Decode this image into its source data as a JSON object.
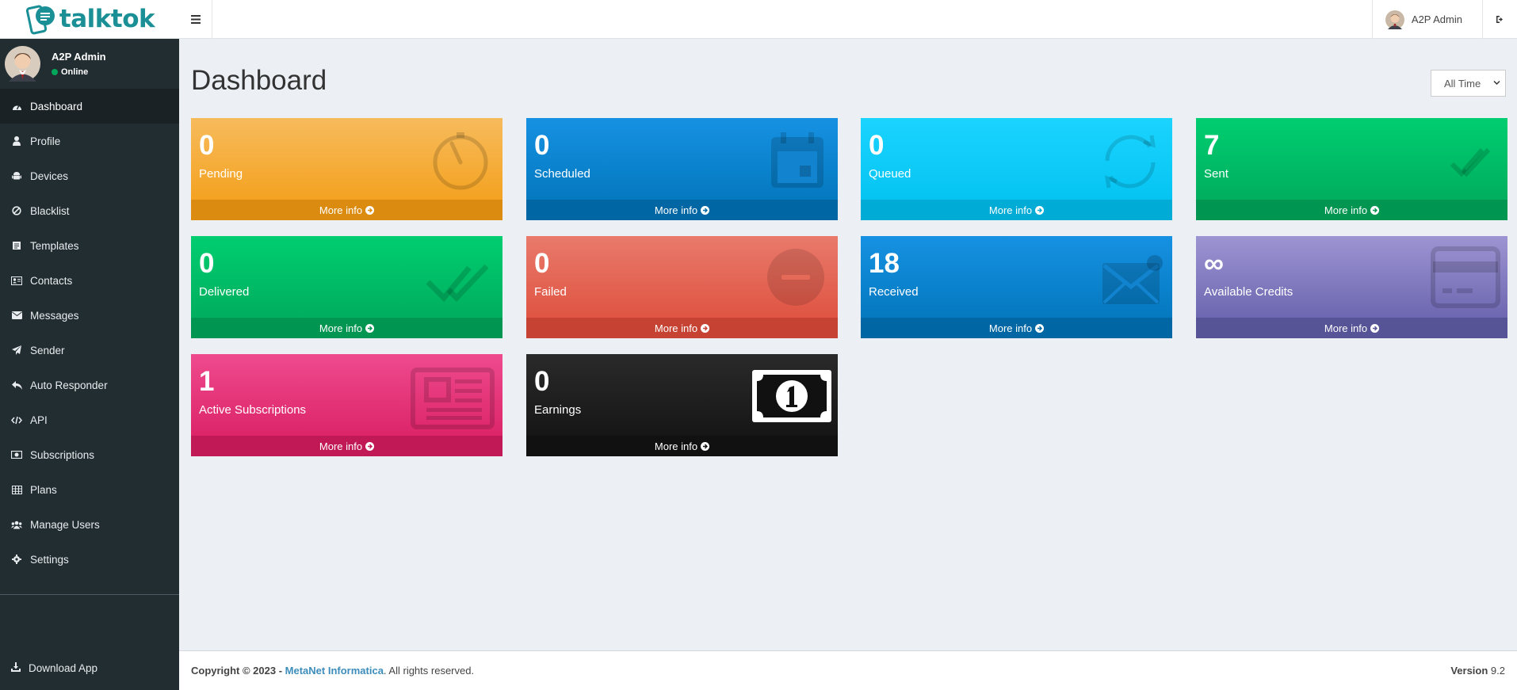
{
  "brand": {
    "name": "talktok",
    "color": "#1a8f95"
  },
  "topbar": {
    "user_name": "A2P Admin"
  },
  "sidebar": {
    "user": {
      "name": "A2P Admin",
      "status": "Online"
    },
    "items": [
      {
        "label": "Dashboard",
        "icon": "dashboard-icon",
        "active": true
      },
      {
        "label": "Profile",
        "icon": "user-icon"
      },
      {
        "label": "Devices",
        "icon": "android-icon"
      },
      {
        "label": "Blacklist",
        "icon": "ban-icon"
      },
      {
        "label": "Templates",
        "icon": "template-icon"
      },
      {
        "label": "Contacts",
        "icon": "address-card-icon"
      },
      {
        "label": "Messages",
        "icon": "envelope-icon"
      },
      {
        "label": "Sender",
        "icon": "paper-plane-icon"
      },
      {
        "label": "Auto Responder",
        "icon": "reply-icon"
      },
      {
        "label": "API",
        "icon": "code-icon"
      },
      {
        "label": "Subscriptions",
        "icon": "money-icon"
      },
      {
        "label": "Plans",
        "icon": "table-icon"
      },
      {
        "label": "Manage Users",
        "icon": "users-icon"
      },
      {
        "label": "Settings",
        "icon": "gear-icon"
      }
    ],
    "download_label": "Download App"
  },
  "page": {
    "title": "Dashboard",
    "range_value": "All Time"
  },
  "boxes": [
    {
      "value": "0",
      "label": "Pending",
      "color": "#f39c12",
      "icon": "tachometer-icon",
      "more": "More info"
    },
    {
      "value": "0",
      "label": "Scheduled",
      "color": "#0073b7",
      "icon": "calendar-icon",
      "more": "More info"
    },
    {
      "value": "0",
      "label": "Queued",
      "color": "#00c0ef",
      "icon": "refresh-icon",
      "more": "More info"
    },
    {
      "value": "7",
      "label": "Sent",
      "color": "#00a65a",
      "icon": "double-check-icon",
      "more": "More info"
    },
    {
      "value": "0",
      "label": "Delivered",
      "color": "#00a65a",
      "icon": "double-check-icon",
      "more": "More info"
    },
    {
      "value": "0",
      "label": "Failed",
      "color": "#dd4b39",
      "icon": "minus-circle-icon",
      "more": "More info"
    },
    {
      "value": "18",
      "label": "Received",
      "color": "#0073b7",
      "icon": "envelope-icon",
      "more": "More info"
    },
    {
      "value": "∞",
      "label": "Available Credits",
      "color": "#605ca8",
      "icon": "credit-card-icon",
      "more": "More info"
    },
    {
      "value": "1",
      "label": "Active Subscriptions",
      "color": "#d81b60",
      "icon": "newspaper-icon",
      "more": "More info"
    },
    {
      "value": "0",
      "label": "Earnings",
      "color": "#111111",
      "icon": "banknote-icon",
      "more": "More info"
    }
  ],
  "footer": {
    "copyright": "Copyright © 2023 -",
    "company": "MetaNet Informatica",
    "rights": ". All rights reserved.",
    "version_label": "Version",
    "version": "9.2"
  }
}
